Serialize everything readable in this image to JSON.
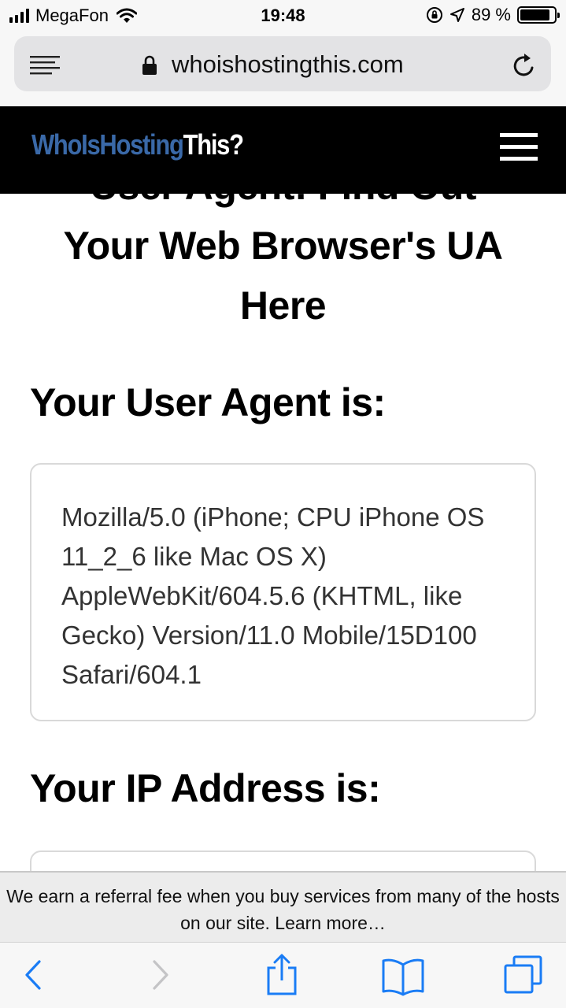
{
  "status_bar": {
    "carrier": "MegaFon",
    "time": "19:48",
    "battery": "89 %",
    "battery_level": 0.89
  },
  "browser": {
    "url": "whoishostingthis.com"
  },
  "site": {
    "logo_part1": "WhoIs",
    "logo_part2": "Hosting",
    "logo_part3": "This?"
  },
  "main": {
    "title_line1": "User Agent: Find Out",
    "title_line2": "Your Web Browser's UA",
    "title_line3": "Here",
    "ua_heading": "Your User Agent is:",
    "ua_value": "Mozilla/5.0 (iPhone; CPU iPhone OS 11_2_6 like Mac OS X) AppleWebKit/604.5.6 (KHTML, like Gecko) Version/11.0 Mobile/15D100 Safari/604.1",
    "ip_heading": "Your IP Address is:"
  },
  "referral": {
    "text": "We earn a referral fee when you buy services from many of the hosts on our site.",
    "link": "Learn more…"
  },
  "colors": {
    "logo_blue": "#3a69a8",
    "ios_blue": "#1a7cf5",
    "header_bg": "#000000"
  },
  "toolbar": {
    "icons": [
      "back-icon",
      "forward-icon",
      "share-icon",
      "bookmarks-icon",
      "tabs-icon"
    ]
  }
}
